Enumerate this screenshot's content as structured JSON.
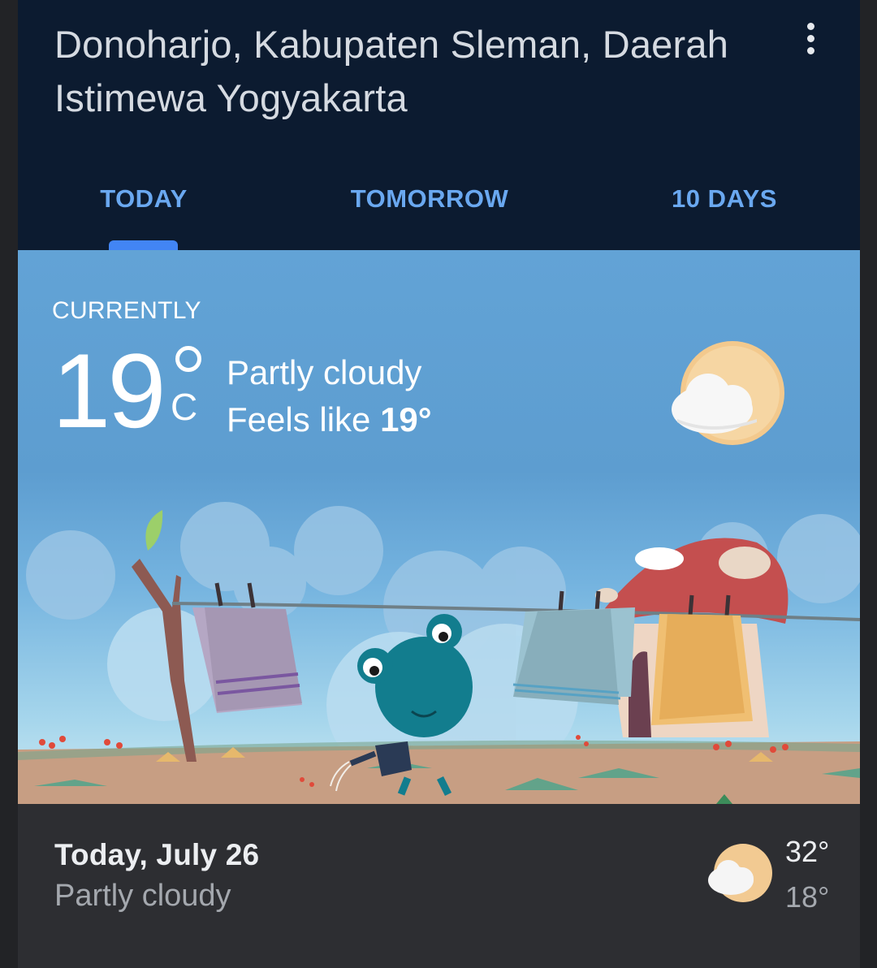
{
  "location": {
    "line1": "Donoharjo, Kabupaten Sleman, Daerah",
    "line2": "Istimewa Yogyakarta"
  },
  "tabs": [
    {
      "label": "TODAY",
      "selected": true
    },
    {
      "label": "TOMORROW",
      "selected": false
    },
    {
      "label": "10 DAYS",
      "selected": false
    }
  ],
  "current": {
    "label": "CURRENTLY",
    "temperature": "19",
    "unit": "C",
    "condition": "Partly cloudy",
    "feels_prefix": "Feels like ",
    "feels_value": "19°",
    "icon": "partly-cloudy-icon"
  },
  "forecast": {
    "title": "Today, July 26",
    "condition": "Partly cloudy",
    "high": "32°",
    "low": "18°",
    "icon": "partly-cloudy-icon"
  },
  "colors": {
    "header_bg": "#0c1b30",
    "accent": "#4285f4",
    "tab_text": "#6aa8f0",
    "sky": "#5d9dd0",
    "footer_bg": "#2d2e32"
  }
}
